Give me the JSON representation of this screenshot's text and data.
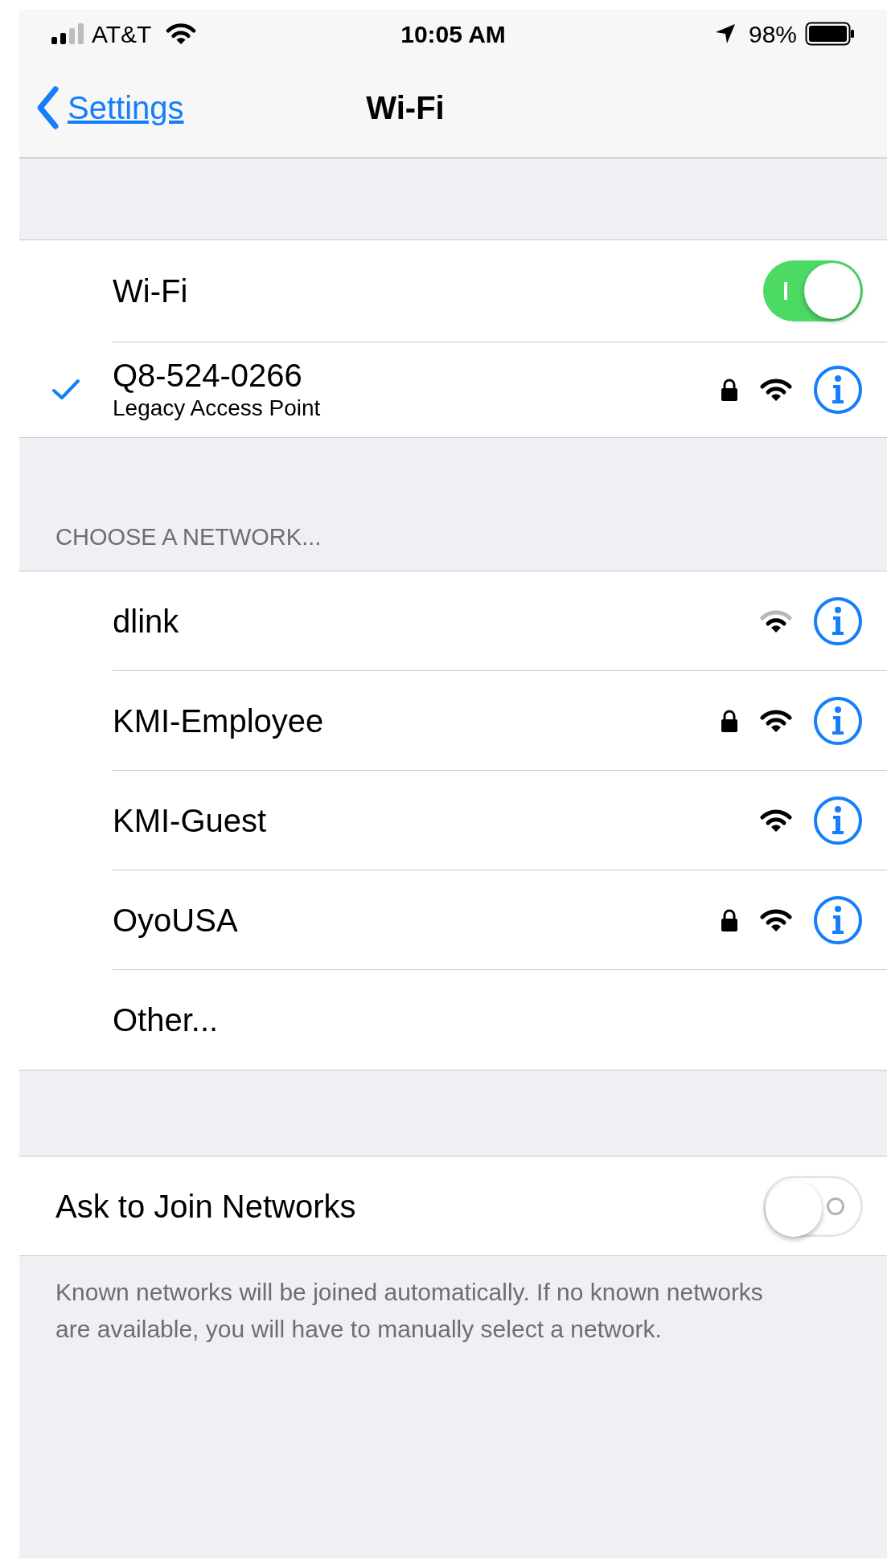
{
  "status_bar": {
    "carrier": "AT&T",
    "time": "10:05 AM",
    "battery": "98%"
  },
  "nav": {
    "back": "Settings",
    "title": "Wi-Fi"
  },
  "wifi_toggle": {
    "label": "Wi-Fi",
    "on": true
  },
  "connected": {
    "name": "Q8-524-0266",
    "subtitle": "Legacy Access Point",
    "checked": true,
    "locked": true,
    "weak_signal": false
  },
  "section_header": "CHOOSE A NETWORK...",
  "networks": [
    {
      "kind": "network",
      "name": "dlink",
      "locked": false,
      "weak_signal": true
    },
    {
      "kind": "network",
      "name": "KMI-Employee",
      "locked": true,
      "weak_signal": false
    },
    {
      "kind": "network",
      "name": "KMI-Guest",
      "locked": false,
      "weak_signal": false
    },
    {
      "kind": "network",
      "name": "OyoUSA",
      "locked": true,
      "weak_signal": false
    },
    {
      "kind": "other",
      "name": "Other..."
    }
  ],
  "ask_to_join": {
    "label": "Ask to Join Networks",
    "on": false
  },
  "footer": "Known networks will be joined automatically. If no known networks are available, you will have to manually select a network."
}
